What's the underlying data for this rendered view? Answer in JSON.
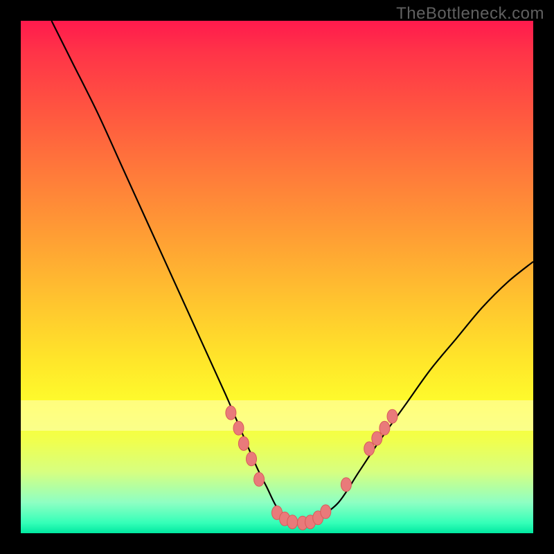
{
  "watermark": "TheBottleneck.com",
  "colors": {
    "background": "#000000",
    "curve": "#000000",
    "marker_fill": "#e97a7a",
    "marker_stroke": "#d85a5a",
    "pale_band": "#ffffc5"
  },
  "chart_data": {
    "type": "line",
    "title": "",
    "xlabel": "",
    "ylabel": "",
    "xlim": [
      0,
      100
    ],
    "ylim": [
      0,
      100
    ],
    "series": [
      {
        "name": "curve",
        "x": [
          6,
          10,
          15,
          20,
          25,
          30,
          35,
          40,
          43,
          46,
          48,
          50,
          52,
          54,
          56,
          58,
          62,
          66,
          70,
          75,
          80,
          85,
          90,
          95,
          100
        ],
        "y": [
          100,
          92,
          82,
          71,
          60,
          49,
          38,
          27,
          20,
          13,
          9,
          5,
          3,
          2,
          2,
          3,
          6,
          12,
          18,
          25,
          32,
          38,
          44,
          49,
          53
        ]
      }
    ],
    "markers": [
      {
        "x": 41.0,
        "y": 23.5
      },
      {
        "x": 42.5,
        "y": 20.5
      },
      {
        "x": 43.5,
        "y": 17.5
      },
      {
        "x": 45.0,
        "y": 14.5
      },
      {
        "x": 46.5,
        "y": 10.5
      },
      {
        "x": 50.0,
        "y": 4.0
      },
      {
        "x": 51.5,
        "y": 2.8
      },
      {
        "x": 53.0,
        "y": 2.2
      },
      {
        "x": 55.0,
        "y": 2.0
      },
      {
        "x": 56.5,
        "y": 2.2
      },
      {
        "x": 58.0,
        "y": 3.0
      },
      {
        "x": 59.5,
        "y": 4.2
      },
      {
        "x": 63.5,
        "y": 9.5
      },
      {
        "x": 68.0,
        "y": 16.5
      },
      {
        "x": 69.5,
        "y": 18.5
      },
      {
        "x": 71.0,
        "y": 20.5
      },
      {
        "x": 72.5,
        "y": 22.8
      }
    ],
    "pale_band_y": [
      20,
      26
    ]
  }
}
